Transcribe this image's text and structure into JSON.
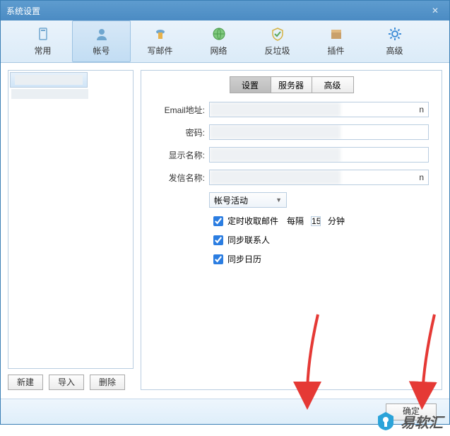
{
  "window": {
    "title": "系统设置"
  },
  "toolbar": {
    "items": [
      {
        "label": "常用"
      },
      {
        "label": "帐号"
      },
      {
        "label": "写邮件"
      },
      {
        "label": "网络"
      },
      {
        "label": "反垃圾"
      },
      {
        "label": "插件"
      },
      {
        "label": "高级"
      }
    ]
  },
  "left": {
    "new": "新建",
    "import": "导入",
    "delete": "删除"
  },
  "tabs": {
    "settings": "设置",
    "server": "服务器",
    "advanced": "高级"
  },
  "form": {
    "email_label": "Email地址:",
    "email_tail": "n",
    "password_label": "密码:",
    "display_label": "显示名称:",
    "sender_label": "发信名称:",
    "sender_tail": "n",
    "activity": "帐号活动",
    "fetch_label": "定时收取邮件",
    "every": "每隔",
    "minutes_value": "15",
    "minutes_suffix": "分钟",
    "sync_contacts": "同步联系人",
    "sync_calendar": "同步日历"
  },
  "footer": {
    "ok": "确定"
  },
  "watermark": {
    "text": "易软汇"
  }
}
